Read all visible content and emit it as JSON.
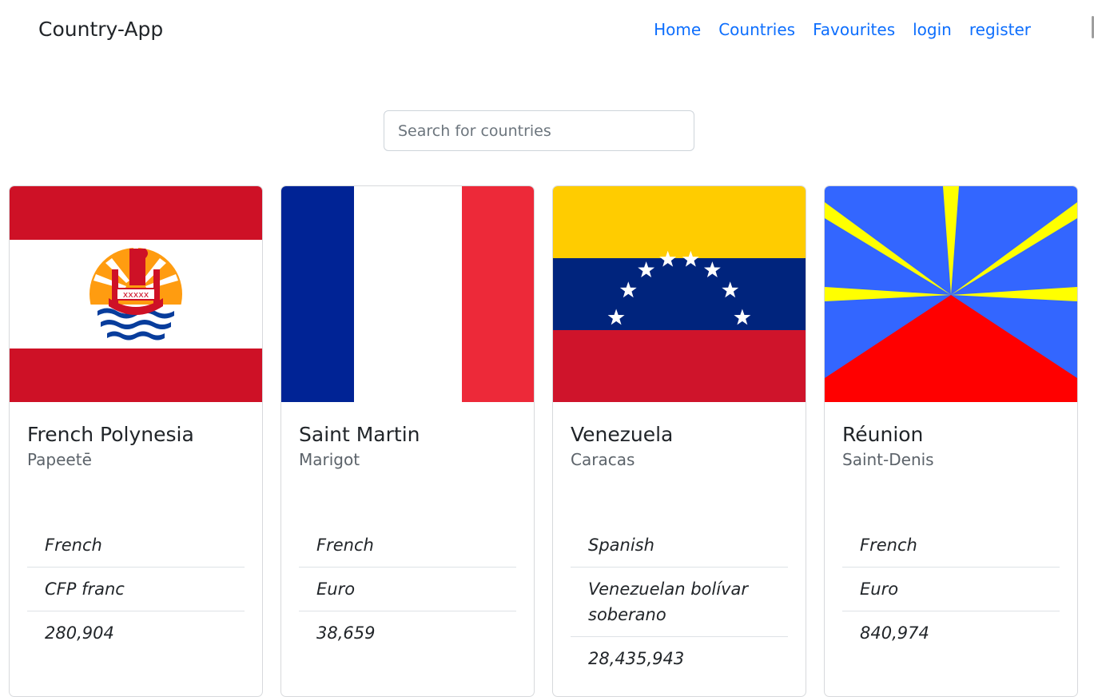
{
  "app": {
    "brand": "Country-App"
  },
  "nav": {
    "items": [
      {
        "label": "Home"
      },
      {
        "label": "Countries"
      },
      {
        "label": "Favourites"
      },
      {
        "label": "login"
      },
      {
        "label": "register"
      }
    ]
  },
  "search": {
    "placeholder": "Search for countries",
    "value": ""
  },
  "colors": {
    "link": "#0d6efd",
    "text": "#212529"
  },
  "cards": [
    {
      "name": "French Polynesia",
      "capital": "Papeetē",
      "language": "French",
      "currency": "CFP franc",
      "population": "280,904",
      "flag": "french-polynesia-flag"
    },
    {
      "name": "Saint Martin",
      "capital": "Marigot",
      "language": "French",
      "currency": "Euro",
      "population": "38,659",
      "flag": "saint-martin-flag"
    },
    {
      "name": "Venezuela",
      "capital": "Caracas",
      "language": "Spanish",
      "currency": "Venezuelan bolívar soberano",
      "population": "28,435,943",
      "flag": "venezuela-flag"
    },
    {
      "name": "Réunion",
      "capital": "Saint-Denis",
      "language": "French",
      "currency": "Euro",
      "population": "840,974",
      "flag": "reunion-flag"
    }
  ]
}
